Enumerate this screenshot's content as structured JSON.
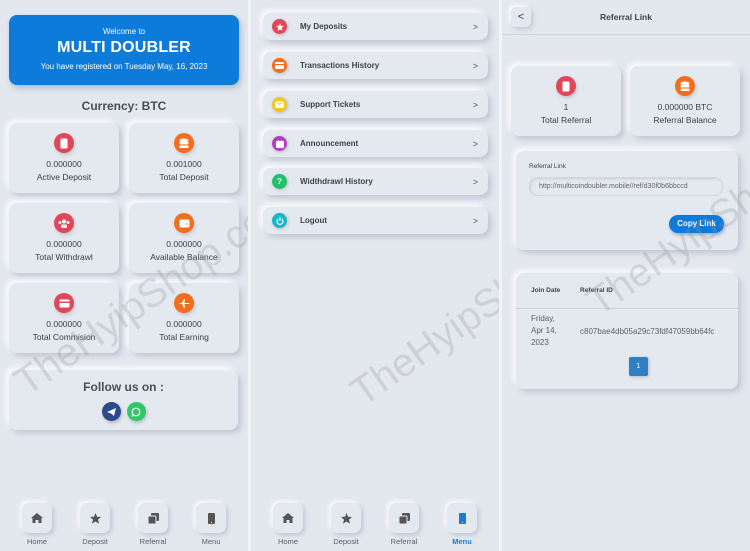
{
  "watermark": "TheHyipShop.com",
  "dashboard": {
    "hero": {
      "welcome": "Welcome to",
      "title": "MULTI DOUBLER",
      "registered": "You have registered on Tuesday May, 16, 2023",
      "color": "#0d7bd9"
    },
    "currency": "Currency: BTC",
    "stats": [
      {
        "value": "0.000000",
        "label": "Active Deposit",
        "icon": "mobile-icon",
        "color": "#e0485a"
      },
      {
        "value": "0.001000",
        "label": "Total Deposit",
        "icon": "database-icon",
        "color": "#f26e1c"
      },
      {
        "value": "0.000000",
        "label": "Total Withdrawl",
        "icon": "users-icon",
        "color": "#e0485a"
      },
      {
        "value": "0.000000",
        "label": "Available Balance",
        "icon": "wallet-icon",
        "color": "#f26e1c"
      },
      {
        "value": "0.000000",
        "label": "Total Commision",
        "icon": "credit-card-icon",
        "color": "#e0485a"
      },
      {
        "value": "0.000000",
        "label": "Total Earning",
        "icon": "plane-icon",
        "color": "#f26e1c"
      }
    ],
    "follow": {
      "heading": "Follow us on :",
      "socials": [
        {
          "name": "telegram",
          "color": "#2d4a8a"
        },
        {
          "name": "whatsapp",
          "color": "#2ec866"
        }
      ]
    }
  },
  "menu": {
    "items": [
      {
        "label": "My Deposits",
        "icon": "star-icon",
        "color": "#e0485a"
      },
      {
        "label": "Transactions History",
        "icon": "credit-card-icon",
        "color": "#f26e1c"
      },
      {
        "label": "Support Tickets",
        "icon": "envelope-icon",
        "color": "#f5c518"
      },
      {
        "label": "Announcement",
        "icon": "announcement-icon",
        "color": "#b43cc0"
      },
      {
        "label": "Widthdrawl History",
        "icon": "question-icon",
        "color": "#21c06a"
      },
      {
        "label": "Logout",
        "icon": "power-icon",
        "color": "#18b6c9"
      }
    ],
    "chevron": ">"
  },
  "nav": {
    "items": [
      {
        "label": "Home",
        "icon": "home-icon"
      },
      {
        "label": "Deposit",
        "icon": "star-icon"
      },
      {
        "label": "Referral",
        "icon": "copy-icon"
      },
      {
        "label": "Menu",
        "icon": "mobile-icon"
      }
    ],
    "active_color": "#1b7ad6"
  },
  "referral": {
    "title": "Referral Link",
    "back": "<",
    "stats": [
      {
        "value": "1",
        "label": "Total Referral",
        "icon": "mobile-icon",
        "color": "#e0485a"
      },
      {
        "value": "0.000000 BTC",
        "label": "Referral Balance",
        "icon": "database-icon",
        "color": "#f26e1c"
      }
    ],
    "link_label": "Referral Link",
    "link_value": "http://multicoindoubler.mobile//ref/d30f0b6bbccd",
    "copy_label": "Copy Link",
    "table": {
      "headers": [
        "Join Date",
        "Referral ID"
      ],
      "rows": [
        {
          "date_line1": "Friday,",
          "date_line2": "Apr 14,",
          "date_line3": "2023",
          "id": "c807bae4db05a29c73fdf47059bb64fc"
        }
      ]
    },
    "page": "1"
  }
}
